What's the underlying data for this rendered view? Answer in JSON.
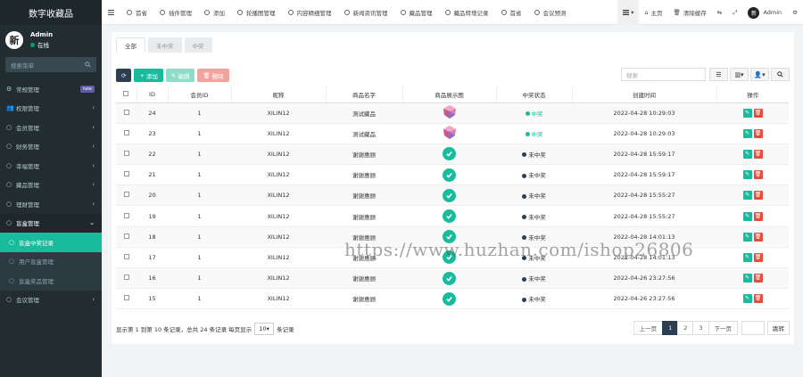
{
  "brand": "数字收藏品",
  "user": {
    "name": "Admin",
    "status": "在线",
    "avatar_char": "新"
  },
  "sidebar": {
    "search_placeholder": "搜索菜单",
    "items": [
      {
        "label": "常规管理",
        "icon": "gear-icon",
        "badge": "new",
        "chevron": false
      },
      {
        "label": "权限管理",
        "icon": "group-icon",
        "chevron": true
      },
      {
        "label": "会员管理",
        "icon": "circle-icon",
        "chevron": true
      },
      {
        "label": "财务管理",
        "icon": "circle-icon",
        "chevron": true
      },
      {
        "label": "幸福管理",
        "icon": "circle-icon",
        "chevron": true
      },
      {
        "label": "藏品管理",
        "icon": "circle-icon",
        "chevron": true
      },
      {
        "label": "理财管理",
        "icon": "circle-icon",
        "chevron": true
      },
      {
        "label": "盲盒管理",
        "icon": "circle-icon",
        "chevron": true,
        "open": true
      }
    ],
    "sub_items": [
      {
        "label": "盲盒中奖记录",
        "active": true
      },
      {
        "label": "用户盲盒管理",
        "active": false
      },
      {
        "label": "盲盒奖品管理",
        "active": false
      }
    ],
    "last_item": {
      "label": "会议管理",
      "icon": "circle-icon",
      "chevron": true
    }
  },
  "topnav": {
    "tabs": [
      "首省",
      "插件管理",
      "添加",
      "轮播图管理",
      "内容精细管理",
      "新闻资讯管理",
      "藏品管理",
      "藏品转增记录",
      "首省",
      "会议预测"
    ],
    "right": {
      "home": "主页",
      "clear_cache": "清除缓存",
      "username": "Admin"
    }
  },
  "panel": {
    "tabs": [
      "全部",
      "未中奖",
      "中奖"
    ],
    "toolbar": {
      "add": "添加",
      "edit": "编辑",
      "delete": "删除"
    },
    "search_placeholder": "搜索",
    "columns": [
      "",
      "ID",
      "会员ID",
      "昵称",
      "商品名字",
      "商品展示图",
      "中奖状态",
      "创建时间",
      "操作"
    ],
    "rows": [
      {
        "id": "24",
        "member_id": "1",
        "nickname": "XILIN12",
        "product": "测试藏品",
        "image": "gem",
        "status": "中奖",
        "win": true,
        "time": "2022-04-28 10:29:03"
      },
      {
        "id": "23",
        "member_id": "1",
        "nickname": "XILIN12",
        "product": "测试藏品",
        "image": "gem",
        "status": "中奖",
        "win": true,
        "time": "2022-04-28 10:29:03"
      },
      {
        "id": "22",
        "member_id": "1",
        "nickname": "XILIN12",
        "product": "谢谢惠顾",
        "image": "check",
        "status": "未中奖",
        "win": false,
        "time": "2022-04-28 15:59:17"
      },
      {
        "id": "21",
        "member_id": "1",
        "nickname": "XILIN12",
        "product": "谢谢惠顾",
        "image": "check",
        "status": "未中奖",
        "win": false,
        "time": "2022-04-28 15:59:17"
      },
      {
        "id": "20",
        "member_id": "1",
        "nickname": "XILIN12",
        "product": "谢谢惠顾",
        "image": "check",
        "status": "未中奖",
        "win": false,
        "time": "2022-04-28 15:55:27"
      },
      {
        "id": "19",
        "member_id": "1",
        "nickname": "XILIN12",
        "product": "谢谢惠顾",
        "image": "check",
        "status": "未中奖",
        "win": false,
        "time": "2022-04-28 15:55:27"
      },
      {
        "id": "18",
        "member_id": "1",
        "nickname": "XILIN12",
        "product": "谢谢惠顾",
        "image": "check",
        "status": "未中奖",
        "win": false,
        "time": "2022-04-28 14:01:13"
      },
      {
        "id": "17",
        "member_id": "1",
        "nickname": "XILIN12",
        "product": "谢谢惠顾",
        "image": "check",
        "status": "未中奖",
        "win": false,
        "time": "2022-04-28 14:01:13"
      },
      {
        "id": "16",
        "member_id": "1",
        "nickname": "XILIN12",
        "product": "谢谢惠顾",
        "image": "check",
        "status": "未中奖",
        "win": false,
        "time": "2022-04-26 23:27:56"
      },
      {
        "id": "15",
        "member_id": "1",
        "nickname": "XILIN12",
        "product": "谢谢惠顾",
        "image": "check",
        "status": "未中奖",
        "win": false,
        "time": "2022-04-26 23:27:56"
      }
    ],
    "footer": {
      "info": "显示第 1 到第 10 条记录，总共 24 条记录 每页显示",
      "page_size": "10",
      "suffix": "条记录"
    },
    "pagination": {
      "prev": "上一页",
      "pages": [
        "1",
        "2",
        "3"
      ],
      "next": "下一页",
      "go": "跳转"
    }
  },
  "watermark": "https://www.huzhan.com/ishop26806"
}
